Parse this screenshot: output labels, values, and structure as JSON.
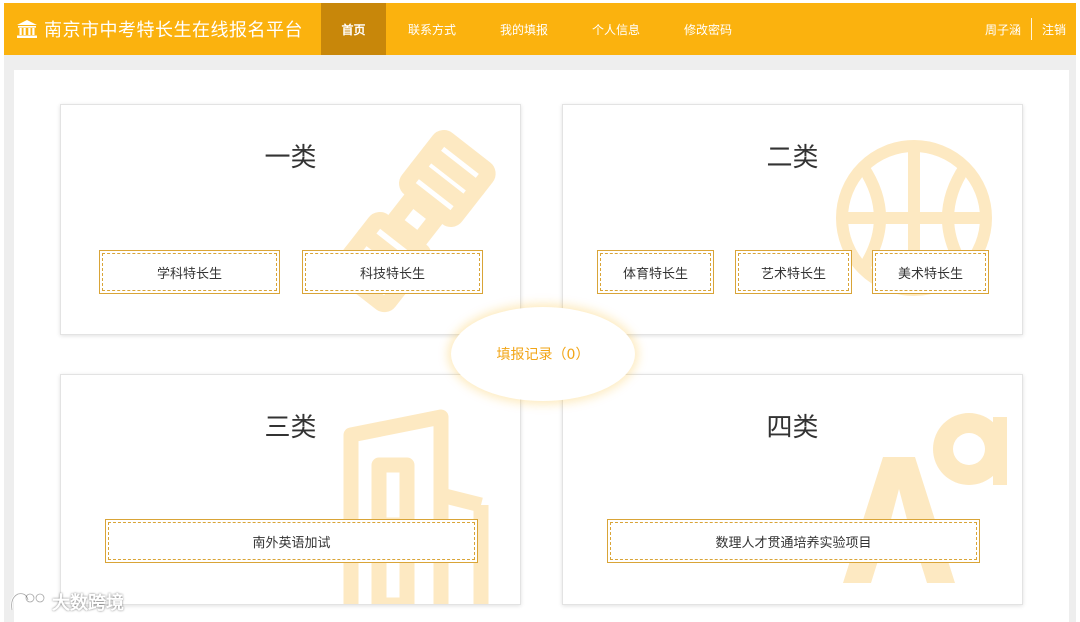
{
  "header": {
    "title": "南京市中考特长生在线报名平台",
    "brand_icon": "institution-building-icon",
    "nav": [
      {
        "label": "首页",
        "active": true
      },
      {
        "label": "联系方式",
        "active": false
      },
      {
        "label": "我的填报",
        "active": false
      },
      {
        "label": "个人信息",
        "active": false
      },
      {
        "label": "修改密码",
        "active": false
      }
    ],
    "user_name": "周子涵",
    "logout_label": "注销"
  },
  "categories": [
    {
      "title": "一类",
      "icon": "satellite-icon",
      "buttons": [
        "学科特长生",
        "科技特长生"
      ]
    },
    {
      "title": "二类",
      "icon": "basketball-icon",
      "buttons": [
        "体育特长生",
        "艺术特长生",
        "美术特长生"
      ]
    },
    {
      "title": "三类",
      "icon": "building-icon",
      "buttons": [
        "南外英语加试"
      ]
    },
    {
      "title": "四类",
      "icon": "font-letters-icon",
      "buttons": [
        "数理人才贯通培养实验项目"
      ]
    }
  ],
  "record": {
    "label": "填报记录（0）"
  },
  "watermark": {
    "text": "大数跨境",
    "icon": "watermark-logo-icon"
  },
  "colors": {
    "primary": "#fbb20e",
    "active_nav": "#c8870a",
    "accent_text": "#f2a516",
    "icon_tint": "#fde9c2",
    "button_border": "#d9a437"
  }
}
